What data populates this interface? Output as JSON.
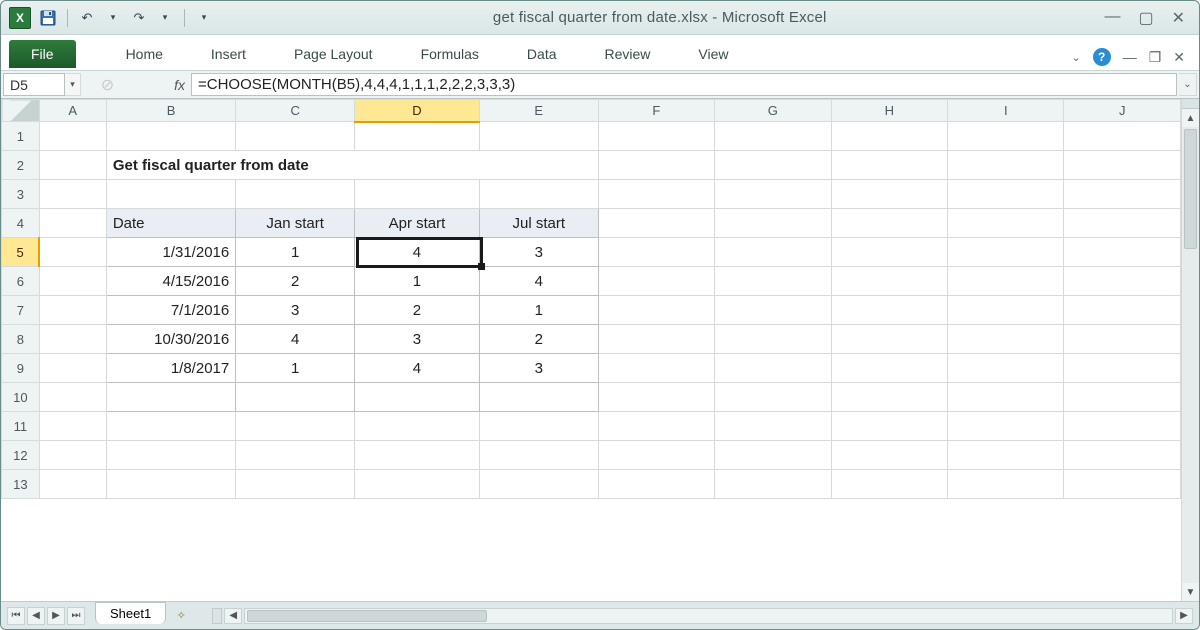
{
  "window": {
    "title": "get fiscal quarter from date.xlsx  -  Microsoft Excel"
  },
  "ribbon": {
    "file": "File",
    "tabs": [
      "Home",
      "Insert",
      "Page Layout",
      "Formulas",
      "Data",
      "Review",
      "View"
    ]
  },
  "namebox": "D5",
  "fx_label": "fx",
  "formula": "=CHOOSE(MONTH(B5),4,4,4,1,1,1,2,2,2,3,3,3)",
  "columns": [
    "A",
    "B",
    "C",
    "D",
    "E",
    "F",
    "G",
    "H",
    "I",
    "J"
  ],
  "rows": [
    "1",
    "2",
    "3",
    "4",
    "5",
    "6",
    "7",
    "8",
    "9",
    "10",
    "11",
    "12",
    "13"
  ],
  "sheet": {
    "title": "Get fiscal quarter from date",
    "headers": {
      "date": "Date",
      "jan": "Jan start",
      "apr": "Apr start",
      "jul": "Jul start"
    },
    "data": [
      {
        "date": "1/31/2016",
        "jan": "1",
        "apr": "4",
        "jul": "3"
      },
      {
        "date": "4/15/2016",
        "jan": "2",
        "apr": "1",
        "jul": "4"
      },
      {
        "date": "7/1/2016",
        "jan": "3",
        "apr": "2",
        "jul": "1"
      },
      {
        "date": "10/30/2016",
        "jan": "4",
        "apr": "3",
        "jul": "2"
      },
      {
        "date": "1/8/2017",
        "jan": "1",
        "apr": "4",
        "jul": "3"
      }
    ]
  },
  "active": {
    "col": "D",
    "row": "5"
  },
  "tabs": {
    "sheet1": "Sheet1"
  }
}
